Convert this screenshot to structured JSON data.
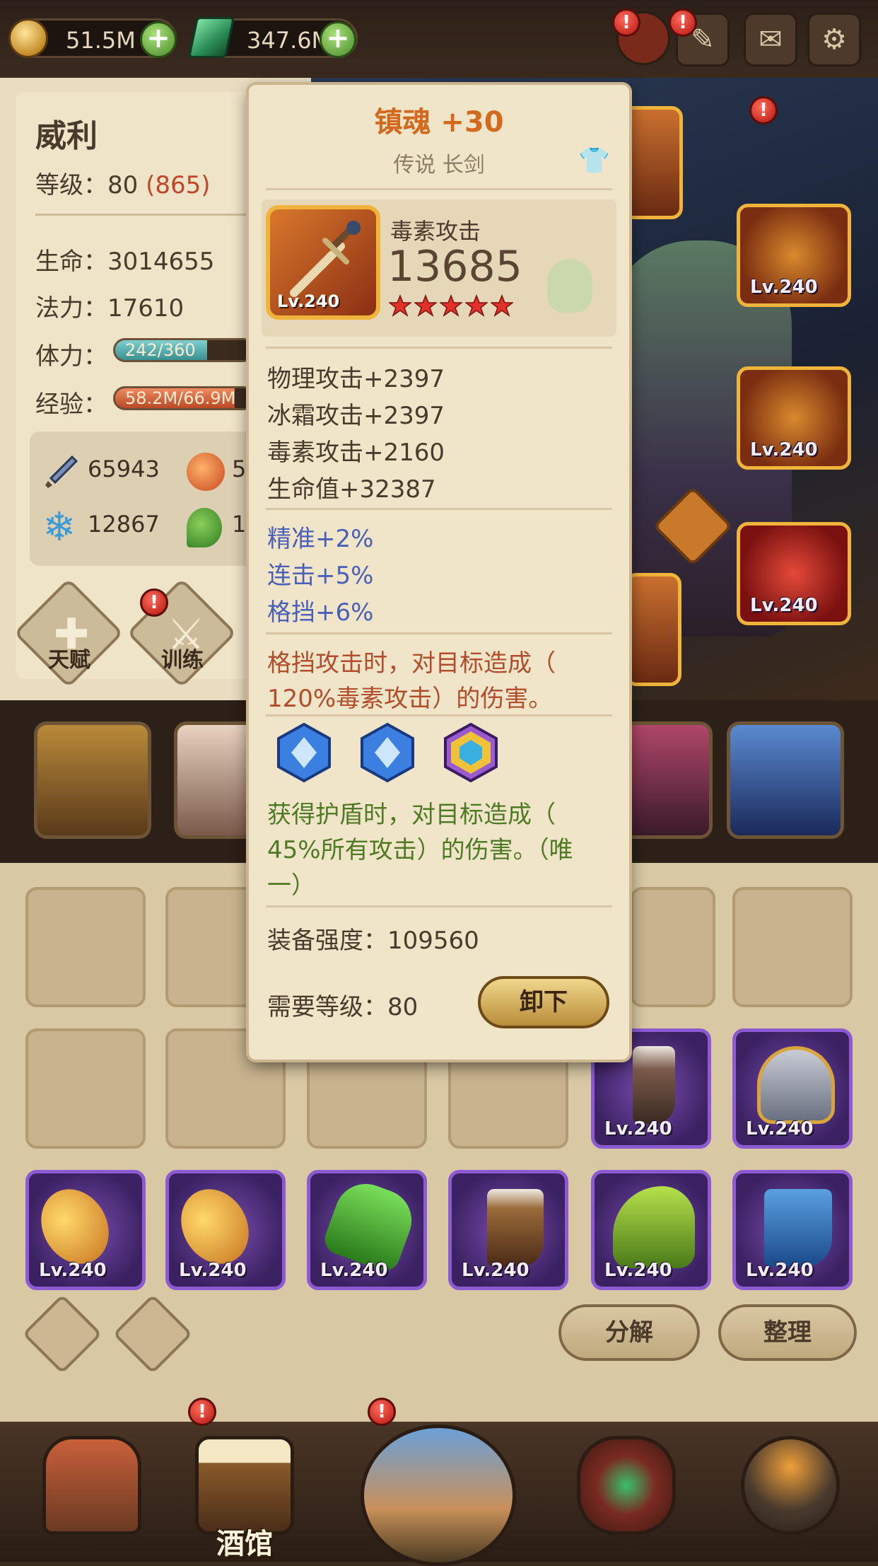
{
  "topbar": {
    "gold": "51.5M",
    "gems": "347.6M"
  },
  "hero": {
    "name": "威利",
    "level_label": "等级：",
    "level": "80",
    "level_extra": "(865)",
    "hp_label": "生命：",
    "hp": "3014655",
    "mp_label": "法力：",
    "mp": "17610",
    "stamina_label": "体力：",
    "stamina": "242/360",
    "stamina_fraction": 0.672,
    "exp_label": "经验：",
    "exp": "58.2M/66.9M",
    "exp_fraction": 0.87,
    "attack": "65943",
    "fire_partial": "5",
    "ice": "12867",
    "poison_partial": "1",
    "talent_label": "天赋",
    "train_label": "训练"
  },
  "tooltip": {
    "title": "镇魂 +30",
    "subtitle": "传说 长剑",
    "weapon_level": "Lv.240",
    "main_stat_name": "毒素攻击",
    "main_stat_value": "13685",
    "stars": 5,
    "stats": [
      "物理攻击+2397",
      "冰霜攻击+2397",
      "毒素攻击+2160",
      "生命值+32387"
    ],
    "bonus": [
      "精准+2%",
      "连击+5%",
      "格挡+6%"
    ],
    "skill_text_1": "格挡攻击时，对目标造成（",
    "skill_text_2": "120%毒素攻击）的伤害。",
    "gem_skill_1": "获得护盾时，对目标造成（",
    "gem_skill_2": "45%所有攻击）的伤害。（唯",
    "gem_skill_3": "一）",
    "power_label": "装备强度：",
    "power": "109560",
    "req_label": "需要等级：",
    "req_level": "80",
    "unequip_label": "卸下"
  },
  "equipped": {
    "levels": [
      "Lv.240",
      "Lv.240",
      "Lv.240"
    ]
  },
  "inventory": {
    "row2_levels": [
      "Lv.240",
      "Lv.240"
    ],
    "row3_levels": [
      "Lv.240",
      "Lv.240",
      "Lv.240",
      "Lv.240",
      "Lv.240",
      "Lv.240"
    ],
    "decompose_label": "分解",
    "sort_label": "整理"
  },
  "nav": {
    "tavern_label": "酒馆"
  },
  "colors": {
    "accent_orange": "#d2691e",
    "epic_purple": "#8e5ad2",
    "legend_gold": "#f0b43a",
    "notice_red": "#b3140e"
  },
  "icons": [
    "gold-coin-icon",
    "gem-icon",
    "plus-icon",
    "chat-icon",
    "mail-icon",
    "gear-icon",
    "shirt-icon",
    "sword-icon",
    "star-icon",
    "skull-icon"
  ]
}
